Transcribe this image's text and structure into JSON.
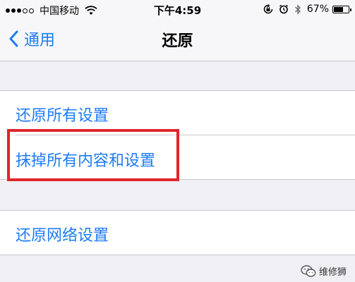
{
  "status_bar": {
    "carrier": "中国移动",
    "time": "下午4:59",
    "battery_percent": "67%",
    "battery_level": 0.67,
    "signal_bars_filled": 3,
    "signal_bars_total": 5,
    "icons": [
      "wifi-icon",
      "rotation-lock-icon",
      "alarm-icon",
      "bluetooth-icon",
      "battery-icon"
    ]
  },
  "nav": {
    "back_label": "通用",
    "title": "还原"
  },
  "groups": [
    {
      "items": [
        {
          "label": "还原所有设置"
        },
        {
          "label": "抹掉所有内容和设置"
        }
      ]
    },
    {
      "items": [
        {
          "label": "还原网络设置"
        }
      ]
    }
  ],
  "watermark": {
    "text": "维修狮",
    "icon": "wechat-icon"
  },
  "colors": {
    "accent": "#1e7bf5",
    "highlight": "#e0262c",
    "background": "#efeff4"
  }
}
